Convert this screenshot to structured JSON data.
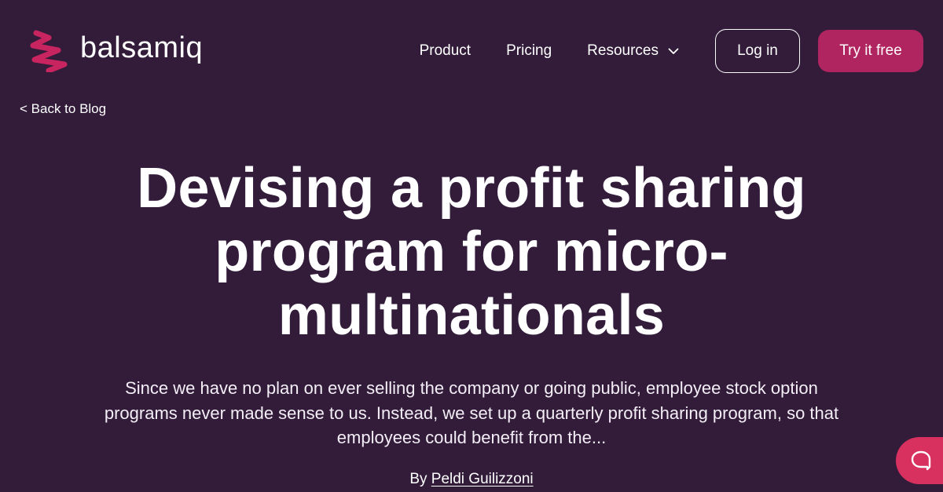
{
  "header": {
    "logo_text": "balsamiq",
    "nav": {
      "product": "Product",
      "pricing": "Pricing",
      "resources": "Resources"
    },
    "login_label": "Log in",
    "try_label": "Try it free"
  },
  "back_link": "< Back to Blog",
  "hero": {
    "title": "Devising a profit sharing program for micro-multinationals",
    "excerpt": "Since we have no plan on ever selling the company or going public, employee stock option programs never made sense to us. Instead, we set up a quarterly profit sharing program, so that employees could benefit from the...",
    "byline_prefix": "By ",
    "author": "Peldi Guilizzoni"
  },
  "colors": {
    "background": "#321c3a",
    "accent": "#b0245f",
    "logo_mark": "#c8245f",
    "help_button": "#d8315f",
    "text": "#ffffff"
  },
  "icons": {
    "logo": "squiggle-logo-icon",
    "resources_dropdown": "chevron-down-icon",
    "help": "chat-bubble-icon"
  }
}
